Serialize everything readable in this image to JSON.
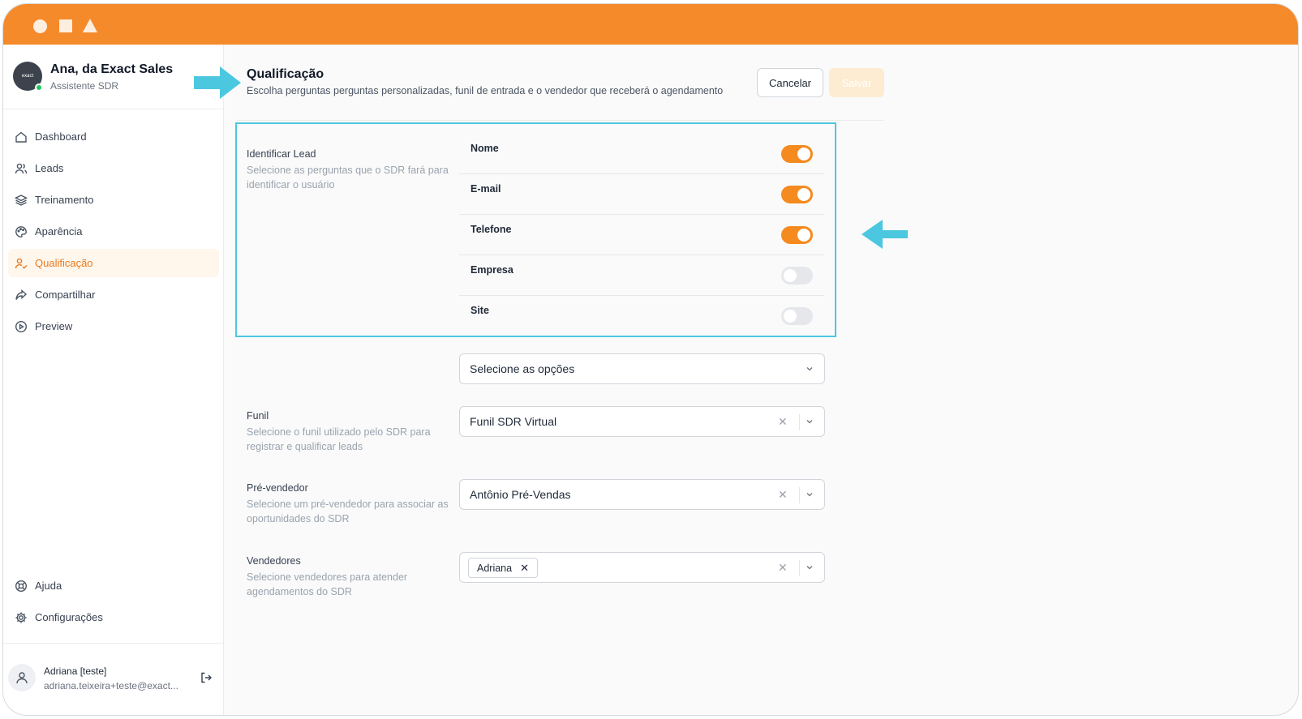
{
  "app": {
    "accent_color": "#f58a2b",
    "highlight_color": "#4cc7e0"
  },
  "sidebar": {
    "profile": {
      "name": "Ana, da Exact Sales",
      "role": "Assistente SDR",
      "avatar_text": "exact"
    },
    "items": [
      {
        "label": "Dashboard",
        "icon": "home-icon"
      },
      {
        "label": "Leads",
        "icon": "users-icon"
      },
      {
        "label": "Treinamento",
        "icon": "layers-icon"
      },
      {
        "label": "Aparência",
        "icon": "palette-icon"
      },
      {
        "label": "Qualificação",
        "icon": "user-check-icon",
        "active": true
      },
      {
        "label": "Compartilhar",
        "icon": "share-icon"
      },
      {
        "label": "Preview",
        "icon": "play-circle-icon"
      }
    ],
    "bottom_items": [
      {
        "label": "Ajuda",
        "icon": "lifebuoy-icon"
      },
      {
        "label": "Configurações",
        "icon": "gear-icon"
      }
    ],
    "user": {
      "name": "Adriana [teste]",
      "email": "adriana.teixeira+teste@exact..."
    }
  },
  "header": {
    "title": "Qualificação",
    "subtitle": "Escolha perguntas perguntas personalizadas, funil de entrada e o vendedor que receberá o agendamento",
    "cancel_label": "Cancelar",
    "save_label": "Salvar"
  },
  "identify_lead": {
    "label": "Identificar Lead",
    "description": "Selecione as perguntas que o SDR fará para identificar o usuário",
    "toggles": [
      {
        "label": "Nome",
        "enabled": true
      },
      {
        "label": "E-mail",
        "enabled": true
      },
      {
        "label": "Telefone",
        "enabled": true
      },
      {
        "label": "Empresa",
        "enabled": false
      },
      {
        "label": "Site",
        "enabled": false
      }
    ],
    "options_placeholder": "Selecione as opções"
  },
  "funil": {
    "label": "Funil",
    "description": "Selecione o funil utilizado pelo SDR para registrar e qualificar leads",
    "value": "Funil SDR Virtual"
  },
  "pre_vendedor": {
    "label": "Pré-vendedor",
    "description": "Selecione um pré-vendedor para associar as oportunidades do SDR",
    "value": "Antônio Pré-Vendas"
  },
  "vendedores": {
    "label": "Vendedores",
    "description": "Selecione vendedores para atender agendamentos do SDR",
    "selected": [
      "Adriana"
    ]
  }
}
